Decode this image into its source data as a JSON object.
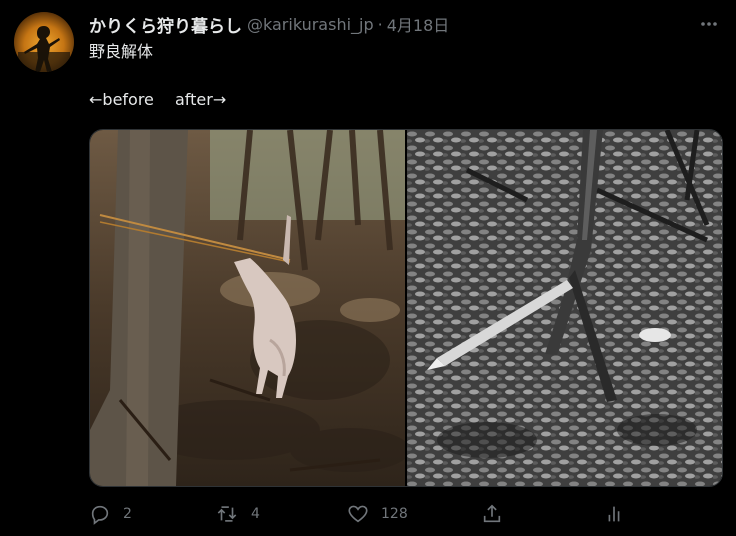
{
  "tweet": {
    "display_name": "かりくら狩り暮らし",
    "handle": "@karikurashi_jp",
    "separator": "·",
    "time": "4月18日",
    "more_icon": "more-horizontal-icon",
    "text": "野良解体\n\n←before　 after→"
  },
  "media": {
    "images": [
      {
        "name": "before-photo"
      },
      {
        "name": "after-photo"
      }
    ]
  },
  "actions": {
    "reply": {
      "icon": "reply-icon",
      "count": "2"
    },
    "retweet": {
      "icon": "retweet-icon",
      "count": "4"
    },
    "like": {
      "icon": "heart-icon",
      "count": "128"
    },
    "share": {
      "icon": "share-icon"
    },
    "analytics": {
      "icon": "analytics-icon"
    }
  },
  "colors": {
    "background": "#000000",
    "text": "#e7e9ea",
    "secondary": "#71767b",
    "border": "#2f3336"
  }
}
